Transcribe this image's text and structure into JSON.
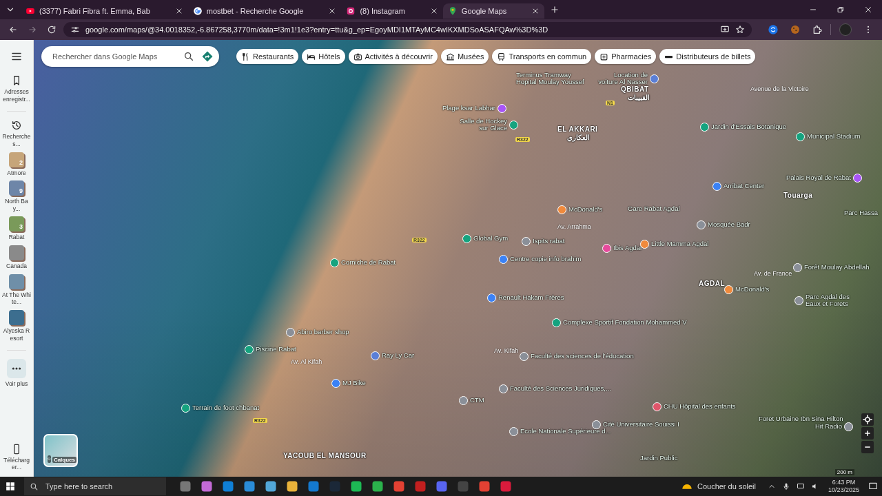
{
  "browser": {
    "tabs": [
      {
        "title": "(3377) Fabri Fibra ft. Emma, Bab",
        "selected": false
      },
      {
        "title": "mostbet - Recherche Google",
        "selected": false
      },
      {
        "title": "(8) Instagram",
        "selected": false
      },
      {
        "title": "Google Maps",
        "selected": true
      }
    ],
    "url": "google.com/maps/@34.0018352,-6.867258,3770m/data=!3m1!1e3?entry=ttu&g_ep=EgoyMDI1MTAyMC4wIKXMDSoASAFQAw%3D%3D"
  },
  "sidebar": {
    "items": [
      {
        "label": "Adresses enregistr...",
        "kind": "bookmark"
      },
      {
        "label": "Recherches...",
        "kind": "history"
      },
      {
        "label": "Atmore",
        "kind": "place",
        "count": "2"
      },
      {
        "label": "North Bay...",
        "kind": "place",
        "count": "9"
      },
      {
        "label": "Rabat",
        "kind": "place",
        "count": "3"
      },
      {
        "label": "Canada",
        "kind": "place"
      },
      {
        "label": "At The White...",
        "kind": "place"
      },
      {
        "label": "Alyeska Resort",
        "kind": "place"
      },
      {
        "label": "Voir plus",
        "kind": "more"
      },
      {
        "label": "Télécharger...",
        "kind": "phone"
      }
    ]
  },
  "search": {
    "placeholder": "Rechercher dans Google Maps"
  },
  "chips": [
    {
      "label": "Restaurants"
    },
    {
      "label": "Hôtels"
    },
    {
      "label": "Activités à découvrir"
    },
    {
      "label": "Musées"
    },
    {
      "label": "Transports en commun"
    },
    {
      "label": "Pharmacies"
    },
    {
      "label": "Distributeurs de billets"
    }
  ],
  "map": {
    "places": [
      {
        "label": "Plage ksar Labhar",
        "kind": "pin",
        "color": "#a855f7"
      },
      {
        "label": "Salle de Hockey sur Glace",
        "kind": "pin",
        "color": "#15a37f"
      },
      {
        "label": "Terminus Tramway Hopital Moulay Youssef",
        "kind": "text"
      },
      {
        "label": "Location de voiture Al Nasser",
        "kind": "pin",
        "color": "#5b7fd6"
      },
      {
        "label": "QBIBAT",
        "kind": "area"
      },
      {
        "label": "القبيبات",
        "kind": "area"
      },
      {
        "label": "EL AKKARI",
        "kind": "area"
      },
      {
        "label": "العكاري",
        "kind": "area"
      },
      {
        "label": "Avenue de la Victoire",
        "kind": "road"
      },
      {
        "label": "Jardin d'Essais Botanique",
        "kind": "pin",
        "color": "#15a37f"
      },
      {
        "label": "Municipal Stadium",
        "kind": "pin",
        "color": "#15a37f"
      },
      {
        "label": "Arribat Center",
        "kind": "pin",
        "color": "#3b82f6"
      },
      {
        "label": "Palais Royal de Rabat",
        "kind": "pin",
        "color": "#a855f7"
      },
      {
        "label": "Touarga",
        "kind": "area"
      },
      {
        "label": "Parc Hassa",
        "kind": "text"
      },
      {
        "label": "McDonald's",
        "kind": "pin",
        "color": "#f08a3c"
      },
      {
        "label": "Gare Rabat Agdal",
        "kind": "text"
      },
      {
        "label": "Av. Arrahma",
        "kind": "road"
      },
      {
        "label": "Mosquée Badr",
        "kind": "pin",
        "color": "#8a8f98"
      },
      {
        "label": "Global Gym",
        "kind": "pin",
        "color": "#15a37f"
      },
      {
        "label": "Ispits rabat",
        "kind": "pin",
        "color": "#8a8f98"
      },
      {
        "label": "Ibis Agdal",
        "kind": "pin",
        "color": "#e64a9c"
      },
      {
        "label": "Little Mamma Agdal",
        "kind": "pin",
        "color": "#f08a3c"
      },
      {
        "label": "Centre copie info brahim",
        "kind": "pin",
        "color": "#3b82f6"
      },
      {
        "label": "Corniche de Rabat",
        "kind": "pin",
        "color": "#15a37f"
      },
      {
        "label": "Av. de France",
        "kind": "road"
      },
      {
        "label": "Forêt Moulay Abdellah",
        "kind": "pin",
        "color": "#8a8f98"
      },
      {
        "label": "McDonald's",
        "kind": "pin",
        "color": "#f08a3c"
      },
      {
        "label": "Renault Hakam Frères",
        "kind": "pin",
        "color": "#3b82f6"
      },
      {
        "label": "Parc Agdal des Eaux et Forets",
        "kind": "pin",
        "color": "#8a8f98"
      },
      {
        "label": "Complexe Sportif Fondation Mohammed V",
        "kind": "pin",
        "color": "#15a37f"
      },
      {
        "label": "AGDAL",
        "kind": "area"
      },
      {
        "label": "Abiro barber shop",
        "kind": "pin",
        "color": "#8a8f98"
      },
      {
        "label": "Piscine Rabat",
        "kind": "pin",
        "color": "#15a37f"
      },
      {
        "label": "Ray Ly Car",
        "kind": "pin",
        "color": "#5b7fd6"
      },
      {
        "label": "Av. Kifah",
        "kind": "road"
      },
      {
        "label": "Av. Al Kifah",
        "kind": "road"
      },
      {
        "label": "Faculté des sciences de l'éducation",
        "kind": "pin",
        "color": "#8a8f98"
      },
      {
        "label": "MJ Bike",
        "kind": "pin",
        "color": "#3b82f6"
      },
      {
        "label": "Faculté des Sciences Juridiques,...",
        "kind": "pin",
        "color": "#8a8f98"
      },
      {
        "label": "CTM",
        "kind": "pin",
        "color": "#8a8f98"
      },
      {
        "label": "Terrain de foot chbanat",
        "kind": "pin",
        "color": "#15a37f"
      },
      {
        "label": "CHU Hôpital des enfants",
        "kind": "pin",
        "color": "#e0566b"
      },
      {
        "label": "Ecole Nationale Supérieure d...",
        "kind": "pin",
        "color": "#8a8f98"
      },
      {
        "label": "Cité Universitaire Souissi I",
        "kind": "pin",
        "color": "#8a8f98"
      },
      {
        "label": "Foret Urbaine Ibn Sina Hilton",
        "kind": "text"
      },
      {
        "label": "Hit Radio",
        "kind": "pin",
        "color": "#8a8f98"
      },
      {
        "label": "Jardin Public",
        "kind": "text"
      },
      {
        "label": "YACOUB EL MANSOUR",
        "kind": "area"
      },
      {
        "label": "R322",
        "kind": "shield"
      },
      {
        "label": "R322",
        "kind": "shield"
      },
      {
        "label": "R322",
        "kind": "shield"
      },
      {
        "label": "N1",
        "kind": "shield"
      }
    ],
    "layers_label": "Calques",
    "scale": "200 m"
  },
  "taskbar": {
    "search_placeholder": "Type here to search",
    "weather": "Coucher du soleil",
    "time": "6:43 PM",
    "date": "10/23/2025"
  }
}
